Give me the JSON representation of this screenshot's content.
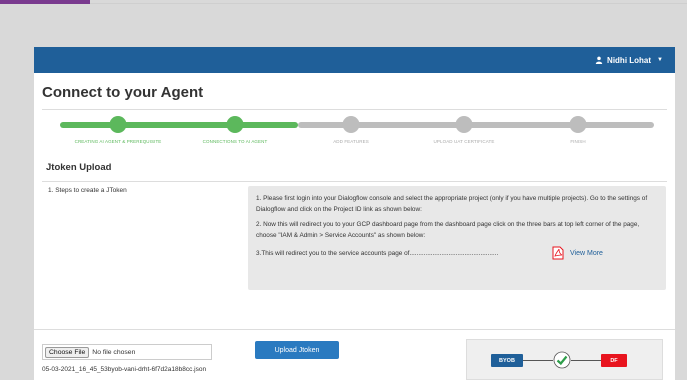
{
  "nav": {
    "user_name": "Nidhi Lohat"
  },
  "page": {
    "title": "Connect to your Agent"
  },
  "stepper": {
    "steps": [
      {
        "label": "CREATING AI AGENT & PREREQUISITE",
        "state": "done"
      },
      {
        "label": "CONNECTIONS TO AI AGENT",
        "state": "done"
      },
      {
        "label": "ADD FEATURES",
        "state": "pending"
      },
      {
        "label": "UPLOAD UAT CERTIFICATE",
        "state": "pending"
      },
      {
        "label": "FINISH",
        "state": "pending"
      }
    ]
  },
  "section": {
    "title": "Jtoken Upload",
    "left_label": "1.  Steps to create a JToken",
    "instructions": [
      "1. Please first login into your Dialogflow console and select the appropriate project (only if you have multiple projects). Go to the settings of Dialogflow and click on the Project ID link as shown below:",
      "2. Now this will redirect you to your GCP dashboard page from the dashboard page click on the three bars at top left corner of the page, choose \"IAM & Admin > Service Accounts\" as shown below:",
      "3.This will redirect you to the service accounts page of.................................................."
    ],
    "view_more": "View More"
  },
  "upload": {
    "choose_file": "Choose File",
    "no_file": "No file chosen",
    "filename": "05-03-2021_16_45_53byob-vani-drht-6f7d2a18b8cc.json",
    "upload_button": "Upload Jtoken"
  },
  "flow": {
    "left": "BYOB",
    "right": "DF"
  },
  "colors": {
    "navbar": "#1f5f99",
    "done": "#5cb85c",
    "pending": "#bdbdbd",
    "accent": "#2a7ac0",
    "df": "#e8141e"
  },
  "icons": {
    "user": "user-icon",
    "caret": "caret-down-icon",
    "pdf": "pdf-icon",
    "check": "check-circle-icon"
  }
}
